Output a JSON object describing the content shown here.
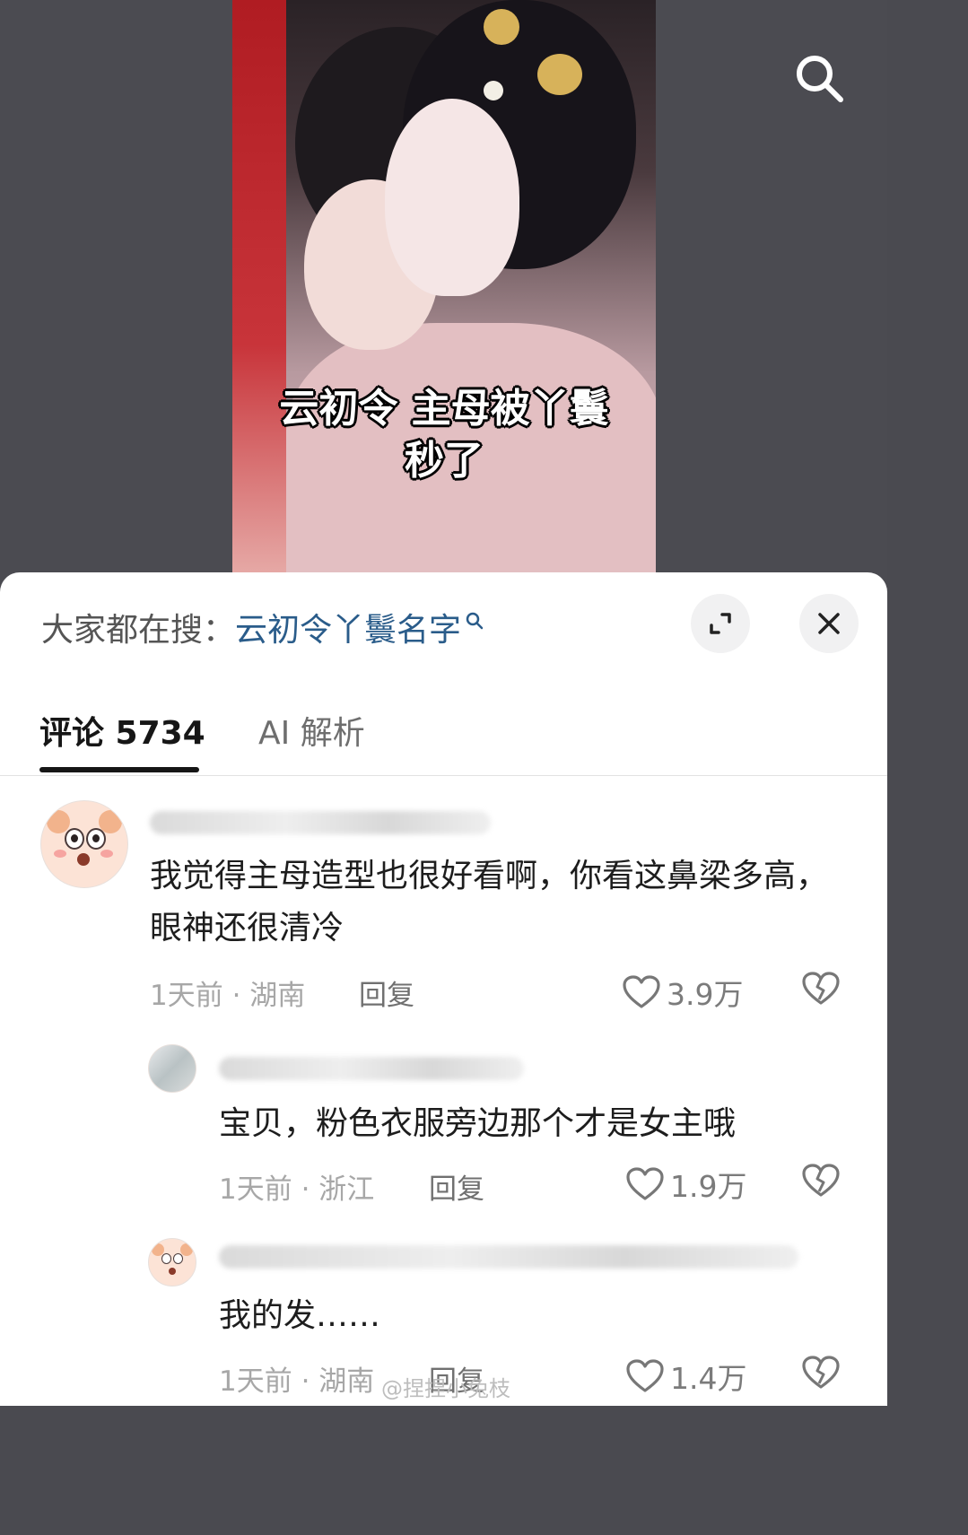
{
  "video": {
    "caption_line1": "云初令 主母被丫鬟",
    "caption_line2": "秒了"
  },
  "search_bar": {
    "label": "大家都在搜：",
    "term": "云初令丫鬟名字"
  },
  "tabs": [
    {
      "label": "评论 5734",
      "active": true
    },
    {
      "label": "AI 解析",
      "active": false
    }
  ],
  "comments": [
    {
      "text": "我觉得主母造型也很好看啊，你看这鼻梁多高，眼神还很清冷",
      "time": "1天前 · 湖南",
      "reply_label": "回复",
      "likes": "3.9万"
    },
    {
      "text": "宝贝，粉色衣服旁边那个才是女主哦",
      "time": "1天前 · 浙江",
      "reply_label": "回复",
      "likes": "1.9万"
    },
    {
      "text": "我的发……",
      "time": "1天前 · 湖南",
      "reply_label": "回复",
      "likes": "1.4万"
    }
  ],
  "watermark": "@捏捏小兔枝",
  "colors": {
    "search_term": "#2a5c8a",
    "tab_active": "#161616",
    "meta_text": "#a7a7a7"
  }
}
